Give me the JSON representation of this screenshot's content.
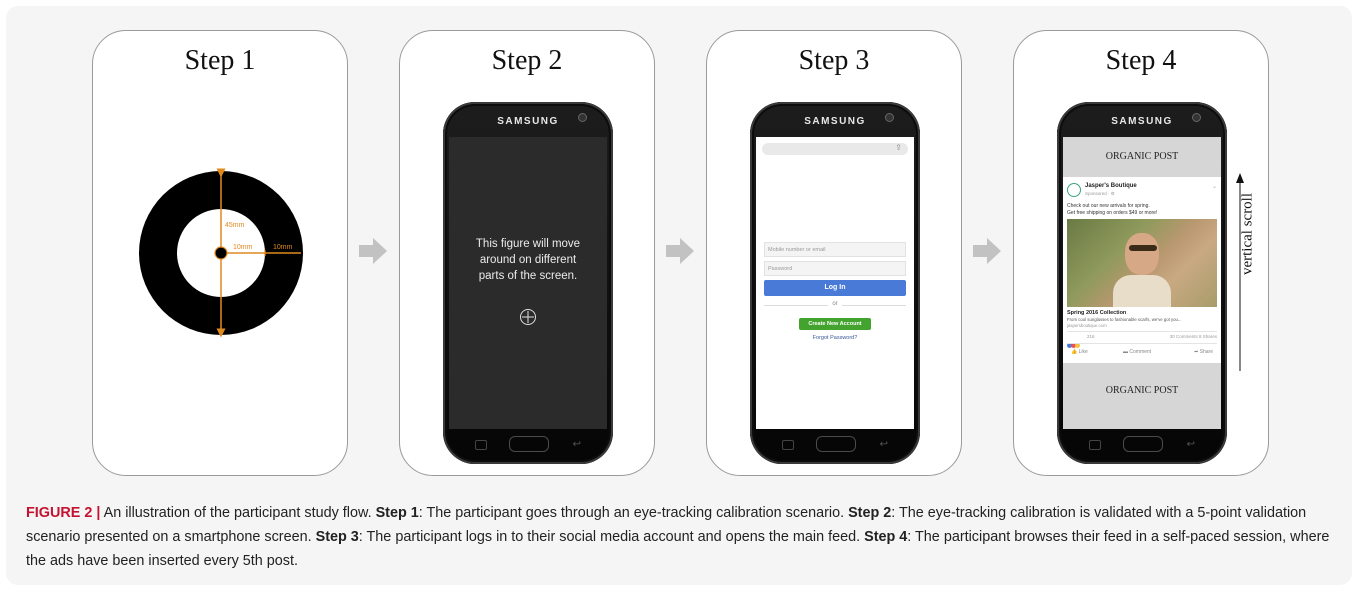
{
  "steps": [
    {
      "title": "Step 1"
    },
    {
      "title": "Step 2"
    },
    {
      "title": "Step 3"
    },
    {
      "title": "Step 4"
    }
  ],
  "phone_brand": "SAMSUNG",
  "step1": {
    "dim_45": "45mm",
    "dim_10a": "10mm",
    "dim_10b": "10mm"
  },
  "step2": {
    "line1": "This figure will move",
    "line2": "around on different",
    "line3": "parts of the screen."
  },
  "step3": {
    "email_placeholder": "Mobile number or email",
    "password_placeholder": "Password",
    "login_label": "Log In",
    "or_label": "or",
    "create_label": "Create New Account",
    "forgot_label": "Forgot Password?"
  },
  "step4": {
    "organic_top": "ORGANIC POST",
    "organic_bottom": "ORGANIC POST",
    "ad_name": "Jasper's Boutique",
    "ad_sponsored": "Sponsored · ⚙",
    "ad_text1": "Check out our new arrivals for spring.",
    "ad_text2": "Get free shipping on orders $49 or more!",
    "link_title": "Spring 2016 Collection",
    "link_desc": "From cool sunglasses to fashionable scarfs, we've got you...",
    "link_url": "jaspersboutique.com",
    "reactions_count": "216",
    "comments_shares": "30 Comments  8 Shares",
    "like_label": "Like",
    "comment_label": "Comment",
    "share_label": "Share",
    "scroll_label": "vertical scroll"
  },
  "caption": {
    "label": "FIGURE 2 |",
    "intro": " An illustration of the participant study flow. ",
    "s1_label": "Step 1",
    "s1_text": ": The participant goes through an eye-tracking calibration scenario. ",
    "s2_label": "Step 2",
    "s2_text": ": The eye-tracking calibration is validated with a 5-point validation scenario presented on a smartphone screen. ",
    "s3_label": "Step 3",
    "s3_text": ": The participant logs in to their social media account and opens the main feed. ",
    "s4_label": "Step 4",
    "s4_text": ": The participant browses their feed in a self-paced session, where the ads have been inserted every 5th post."
  }
}
